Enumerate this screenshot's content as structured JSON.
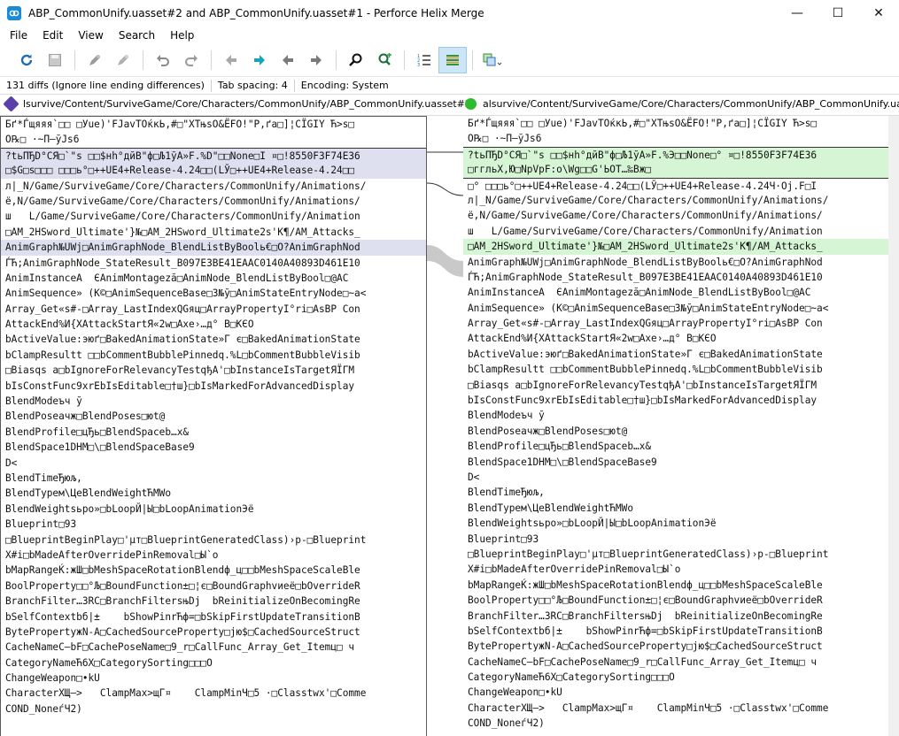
{
  "window": {
    "title": "ABP_CommonUnify.uasset#2 and ABP_CommonUnify.uasset#1 - Perforce Helix Merge",
    "minimize": "—",
    "maximize": "☐",
    "close": "✕"
  },
  "menu": [
    "File",
    "Edit",
    "View",
    "Search",
    "Help"
  ],
  "toolbar": {
    "icons": [
      "refresh-icon",
      "save-icon",
      "pencil-icon",
      "pencil-alt-icon",
      "undo-icon",
      "redo-icon",
      "prev-diff-icon",
      "next-diff-icon",
      "prev-change-icon",
      "next-change-icon",
      "find-icon",
      "find-next-icon",
      "line-numbers-icon",
      "diff-lines-icon",
      "compare-icon"
    ]
  },
  "status": {
    "diffs": "131 diffs (Ignore line ending differences)",
    "tab_spacing": "Tab spacing: 4",
    "encoding": "Encoding: System"
  },
  "paths": {
    "left": "lsurvive/Content/SurviveGame/Core/Characters/CommonUnify/ABP_CommonUnify.uasset#2",
    "right": "alsurvive/Content/SurviveGame/Core/Characters/CommonUnify/ABP_CommonUnify.uasset#1"
  },
  "colors": {
    "left_badge": "#5a3fa8",
    "right_badge": "#2ebc2e",
    "left_highlight": "#dfe0ef",
    "right_highlight": "#d6f5d4"
  },
  "left_lines": [
    {
      "text": "Бґ*Ѓщяяя`□□ □Уue)'FJavTОќкЬ,#□\"XTњsО&ЁFО!\"P,ґа□]¦CЇGIY Ћ>s□",
      "hl": false
    },
    {
      "text": "O℞□ ·~П–ўЈѕ6",
      "hl": false
    },
    {
      "text": "?tьПЂD°СЯ□`\"s □□$нh°дйВ\"ф□Љ1ўА»F.%D\"□□None□I ¤□!8550F3F74E36",
      "hl": true,
      "sep": true
    },
    {
      "text": "□$G□s□□□ □□□ь°□++UE4+Release-4.24□□(LЎ□++UE4+Release-4.24□□",
      "hl": true
    },
    {
      "text": "л|_N/Game/SurviveGame/Core/Characters/CommonUnify/Animations/",
      "hl": false
    },
    {
      "text": "ё,N/Game/SurviveGame/Core/Characters/CommonUnify/Animations/",
      "hl": false
    },
    {
      "text": "ш   L/Game/SurviveGame/Core/Characters/CommonUnify/Animation",
      "hl": false
    },
    {
      "text": "□AM_2HSword_Ultimate'}№□AM_2HSword_Ultimate2s'К¶/AM_Attacks_",
      "hl": false
    },
    {
      "text": "AnimGraph№UWj□AnimGraphNode_BlendListByBoolь€□O?AnimGraphNod",
      "hl": true
    },
    {
      "text": "ЃЋ;AnimGraphNode_StateResult_B097E3BE41EAAC0140A40893D461E10",
      "hl": false
    },
    {
      "text": "AnimInstanceA  ЄAnimMontageză□AnimNode_BlendListByBool□@AC",
      "hl": false
    },
    {
      "text": "AnimSequence» (K©□AnimSequenceBase□3№ў□AnimStateEntryNode□~a<",
      "hl": false
    },
    {
      "text": "Array_Get«s#-□Array_LastIndexQGяц□ArrayPropertyІ°rі□AsBP Con",
      "hl": false
    },
    {
      "text": "AttackEnd%И{XAttackStartЯ«2w□Axe›…д° B□KЄO",
      "hl": false
    },
    {
      "text": "bActiveValue:эюґ□BakedAnimationState»Г є□BakedAnimationState",
      "hl": false
    },
    {
      "text": "bClampResultt □□bCommentBubblePinnedq.%L□bCommentBubbleVisib",
      "hl": false
    },
    {
      "text": "□Biasqs а□bIgnoreForRelevancyTestqђА'□bInstanceIsTargetЯЇГМ",
      "hl": false
    },
    {
      "text": "bIsConstFunc9хrЕbIsEditable□†ш}□bIsMarkedForAdvancedDisplay",
      "hl": false
    },
    {
      "text": "BlendModeъч ў",
      "hl": false
    },
    {
      "text": "BlendPoseaчж□BlendPoses□юt@",
      "hl": false
    },
    {
      "text": "BlendProfile□цЂь□BlendSpaceb…x&",
      "hl": false
    },
    {
      "text": "BlendSpace1DHМ□\\□BlendSpaceBase9",
      "hl": false
    },
    {
      "text": "D<",
      "hl": false
    },
    {
      "text": "BlendTimeЂюљ,",
      "hl": false
    },
    {
      "text": "BlendTypeм\\ЦeBlendWeightЋMWo",
      "hl": false
    },
    {
      "text": "BlendWeightsьро»□bLoopЙ|Ы□bLoopAnimationЭё",
      "hl": false
    },
    {
      "text": "Blueprint□93",
      "hl": false
    },
    {
      "text": "□BlueprintBeginPlay□'μт□BlueprintGeneratedClass)›p-□Blueprint",
      "hl": false
    },
    {
      "text": "X#i□bMadeAfterOverridePinRemoval□Ы`o",
      "hl": false
    },
    {
      "text": "bMapRangeЌ:жШ□bMeshSpaceRotationBlendф_ц□□bMeshSpaceScaleBle",
      "hl": false
    },
    {
      "text": "BoolProperty□□°Љ□BoundFunction±□¦є□BoundGraphvиеё□bOverrideR",
      "hl": false
    },
    {
      "text": "BranchFilter…ЗRC□BranchFiltersњDj  bReinitializeOnBecomingRe",
      "hl": false
    },
    {
      "text": "bSelfContextbб|±    bShowPinrЋф=□bSkipFirstUpdateTransitionB",
      "hl": false
    },
    {
      "text": "BytePropertyжN-A□CachedSourceProperty□jю$□CachedSourceStruct",
      "hl": false
    },
    {
      "text": "CacheNameC—bF□CachePoseName□9_r□CallFunc_Array_Get_Itemц□ ч",
      "hl": false
    },
    {
      "text": "CategoryNameЋ6X□CategorySorting□□□O",
      "hl": false
    },
    {
      "text": "ChangeWeapon□•kU",
      "hl": false
    },
    {
      "text": "CharacterXЩ–>   ClampMax>щГ¤    ClampMinЧ□5 ·□Classtwx'□Comme",
      "hl": false
    },
    {
      "text": "COND_NoneѓЧ2)",
      "hl": false
    }
  ],
  "right_lines": [
    {
      "text": "Бґ*Ѓщяяя`□□ □Уue)'FJavTОќкЬ,#□\"XTњsО&ЁFО!\"P,ґа□]¦CЇGIY Ћ>s□",
      "hl": false
    },
    {
      "text": "O℞□ ·~П–ўЈѕ6",
      "hl": false
    },
    {
      "text": "?tьПЂD°СЯ□`\"s □□$нh°дйВ\"ф□Љ1ўА»F.%Э□□None□° ¤□!8550F3F74E36",
      "hl": true,
      "sep": true
    },
    {
      "text": "□ггльX,Ю□NpVpF:о\\Wg□□G'ЬОТ…‰Вж□",
      "hl": true
    },
    {
      "text": "□° □□□ь°□++UE4+Release-4.24□□(LЎ□++UE4+Release-4.24Ч·Oj.F□I",
      "hl": false,
      "sep": true
    },
    {
      "text": "л|_N/Game/SurviveGame/Core/Characters/CommonUnify/Animations/",
      "hl": false
    },
    {
      "text": "ё,N/Game/SurviveGame/Core/Characters/CommonUnify/Animations/",
      "hl": false
    },
    {
      "text": "ш   L/Game/SurviveGame/Core/Characters/CommonUnify/Animation",
      "hl": false
    },
    {
      "text": "□AM_2HSword_Ultimate'}№□AM_2HSword_Ultimate2s'К¶/AM_Attacks_",
      "hl": true
    },
    {
      "text": "AnimGraph№UWj□AnimGraphNode_BlendListByBoolь€□O?AnimGraphNod",
      "hl": false
    },
    {
      "text": "ЃЋ;AnimGraphNode_StateResult_B097E3BE41EAAC0140A40893D461E10",
      "hl": false
    },
    {
      "text": "AnimInstanceA  ЄAnimMontageză□AnimNode_BlendListByBool□@AC",
      "hl": false
    },
    {
      "text": "AnimSequence» (K©□AnimSequenceBase□3№ў□AnimStateEntryNode□~a<",
      "hl": false
    },
    {
      "text": "Array_Get«s#-□Array_LastIndexQGяц□ArrayPropertyІ°rі□AsBP Con",
      "hl": false
    },
    {
      "text": "AttackEnd%И{XAttackStartЯ«2w□Axe›…д° B□KЄO",
      "hl": false
    },
    {
      "text": "bActiveValue:эюґ□BakedAnimationState»Г є□BakedAnimationState",
      "hl": false
    },
    {
      "text": "bClampResultt □□bCommentBubblePinnedq.%L□bCommentBubbleVisib",
      "hl": false
    },
    {
      "text": "□Biasqs а□bIgnoreForRelevancyTestqђА'□bInstanceIsTargetЯЇГМ",
      "hl": false
    },
    {
      "text": "bIsConstFunc9хrЕbIsEditable□†ш}□bIsMarkedForAdvancedDisplay",
      "hl": false
    },
    {
      "text": "BlendModeъч ў",
      "hl": false
    },
    {
      "text": "BlendPoseaчж□BlendPoses□юt@",
      "hl": false
    },
    {
      "text": "BlendProfile□цЂь□BlendSpaceb…x&",
      "hl": false
    },
    {
      "text": "BlendSpace1DHМ□\\□BlendSpaceBase9",
      "hl": false
    },
    {
      "text": "D<",
      "hl": false
    },
    {
      "text": "BlendTimeЂюљ,",
      "hl": false
    },
    {
      "text": "BlendTypeм\\ЦeBlendWeightЋMWo",
      "hl": false
    },
    {
      "text": "BlendWeightsьро»□bLoopЙ|Ы□bLoopAnimationЭё",
      "hl": false
    },
    {
      "text": "Blueprint□93",
      "hl": false
    },
    {
      "text": "□BlueprintBeginPlay□'μт□BlueprintGeneratedClass)›p-□Blueprint",
      "hl": false
    },
    {
      "text": "X#i□bMadeAfterOverridePinRemoval□Ы`o",
      "hl": false
    },
    {
      "text": "bMapRangeЌ:жШ□bMeshSpaceRotationBlendф_ц□□bMeshSpaceScaleBle",
      "hl": false
    },
    {
      "text": "BoolProperty□□°Љ□BoundFunction±□¦є□BoundGraphvиеё□bOverrideR",
      "hl": false
    },
    {
      "text": "BranchFilter…ЗRC□BranchFiltersњDj  bReinitializeOnBecomingRe",
      "hl": false
    },
    {
      "text": "bSelfContextbб|±    bShowPinrЋф=□bSkipFirstUpdateTransitionB",
      "hl": false
    },
    {
      "text": "BytePropertyжN-A□CachedSourceProperty□jю$□CachedSourceStruct",
      "hl": false
    },
    {
      "text": "CacheNameC—bF□CachePoseName□9_r□CallFunc_Array_Get_Itemц□ ч",
      "hl": false
    },
    {
      "text": "CategoryNameЋ6X□CategorySorting□□□O",
      "hl": false
    },
    {
      "text": "ChangeWeapon□•kU",
      "hl": false
    },
    {
      "text": "CharacterXЩ–>   ClampMax>щГ¤    ClampMinЧ□5 ·□Classtwx'□Comme",
      "hl": false
    },
    {
      "text": "COND_NoneѓЧ2)",
      "hl": false
    }
  ]
}
